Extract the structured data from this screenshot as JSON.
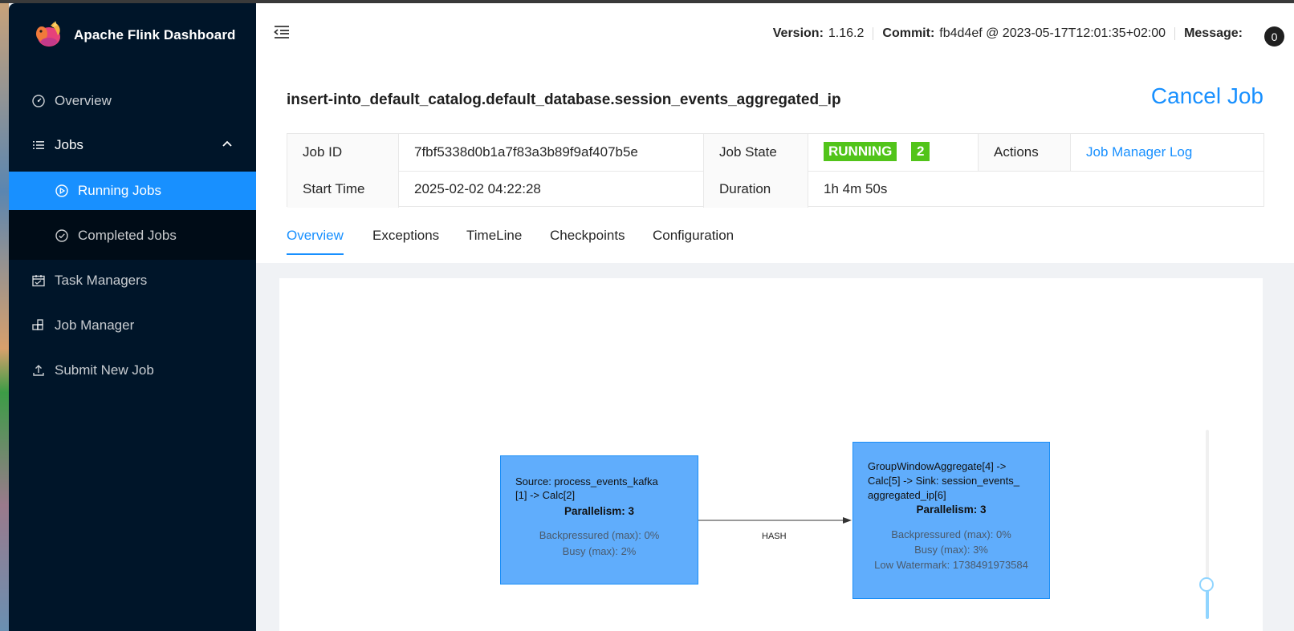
{
  "app": {
    "title": "Apache Flink Dashboard"
  },
  "sidebar": {
    "items": [
      {
        "label": "Overview",
        "icon": "dashboard-icon"
      },
      {
        "label": "Jobs",
        "icon": "unordered-list-icon"
      },
      {
        "label": "Task Managers",
        "icon": "schedule-icon"
      },
      {
        "label": "Job Manager",
        "icon": "build-icon"
      },
      {
        "label": "Submit New Job",
        "icon": "upload-icon"
      }
    ],
    "jobs_sub": [
      {
        "label": "Running Jobs",
        "icon": "play-circle-icon",
        "active": true
      },
      {
        "label": "Completed Jobs",
        "icon": "check-circle-icon",
        "active": false
      }
    ]
  },
  "header": {
    "version_label": "Version:",
    "version_value": "1.16.2",
    "commit_label": "Commit:",
    "commit_value": "fb4d4ef @ 2023-05-17T12:01:35+02:00",
    "message_label": "Message:",
    "message_count": "0"
  },
  "job": {
    "name": "insert-into_default_catalog.default_database.session_events_aggregated_ip",
    "cancel_label": "Cancel Job",
    "id_label": "Job ID",
    "id_value": "7fbf5338d0b1a7f83a3b89f9af407b5e",
    "state_label": "Job State",
    "state_value": "RUNNING",
    "state_count": "2",
    "actions_label": "Actions",
    "actions_link": "Job Manager Log",
    "start_label": "Start Time",
    "start_value": "2025-02-02 04:22:28",
    "duration_label": "Duration",
    "duration_value": "1h 4m 50s"
  },
  "tabs": [
    {
      "label": "Overview",
      "active": true
    },
    {
      "label": "Exceptions",
      "active": false
    },
    {
      "label": "TimeLine",
      "active": false
    },
    {
      "label": "Checkpoints",
      "active": false
    },
    {
      "label": "Configuration",
      "active": false
    }
  ],
  "graph": {
    "nodes": [
      {
        "title_lines": [
          "Source: process_events_kafka",
          "[1] -> Calc[2]"
        ],
        "parallelism": "Parallelism: 3",
        "metrics": [
          "Backpressured (max): 0%",
          "Busy (max): 2%"
        ]
      },
      {
        "title_lines": [
          "GroupWindowAggregate[4] ->",
          "Calc[5] -> Sink: session_events_",
          "aggregated_ip[6]"
        ],
        "parallelism": "Parallelism: 3",
        "metrics": [
          "Backpressured (max): 0%",
          "Busy (max): 3%",
          "Low Watermark: 1738491973584"
        ]
      }
    ],
    "edge_label": "HASH"
  },
  "colors": {
    "sider": "#001529",
    "primary": "#1890ff",
    "running": "#52c41a",
    "node_fill": "#60adfc"
  }
}
